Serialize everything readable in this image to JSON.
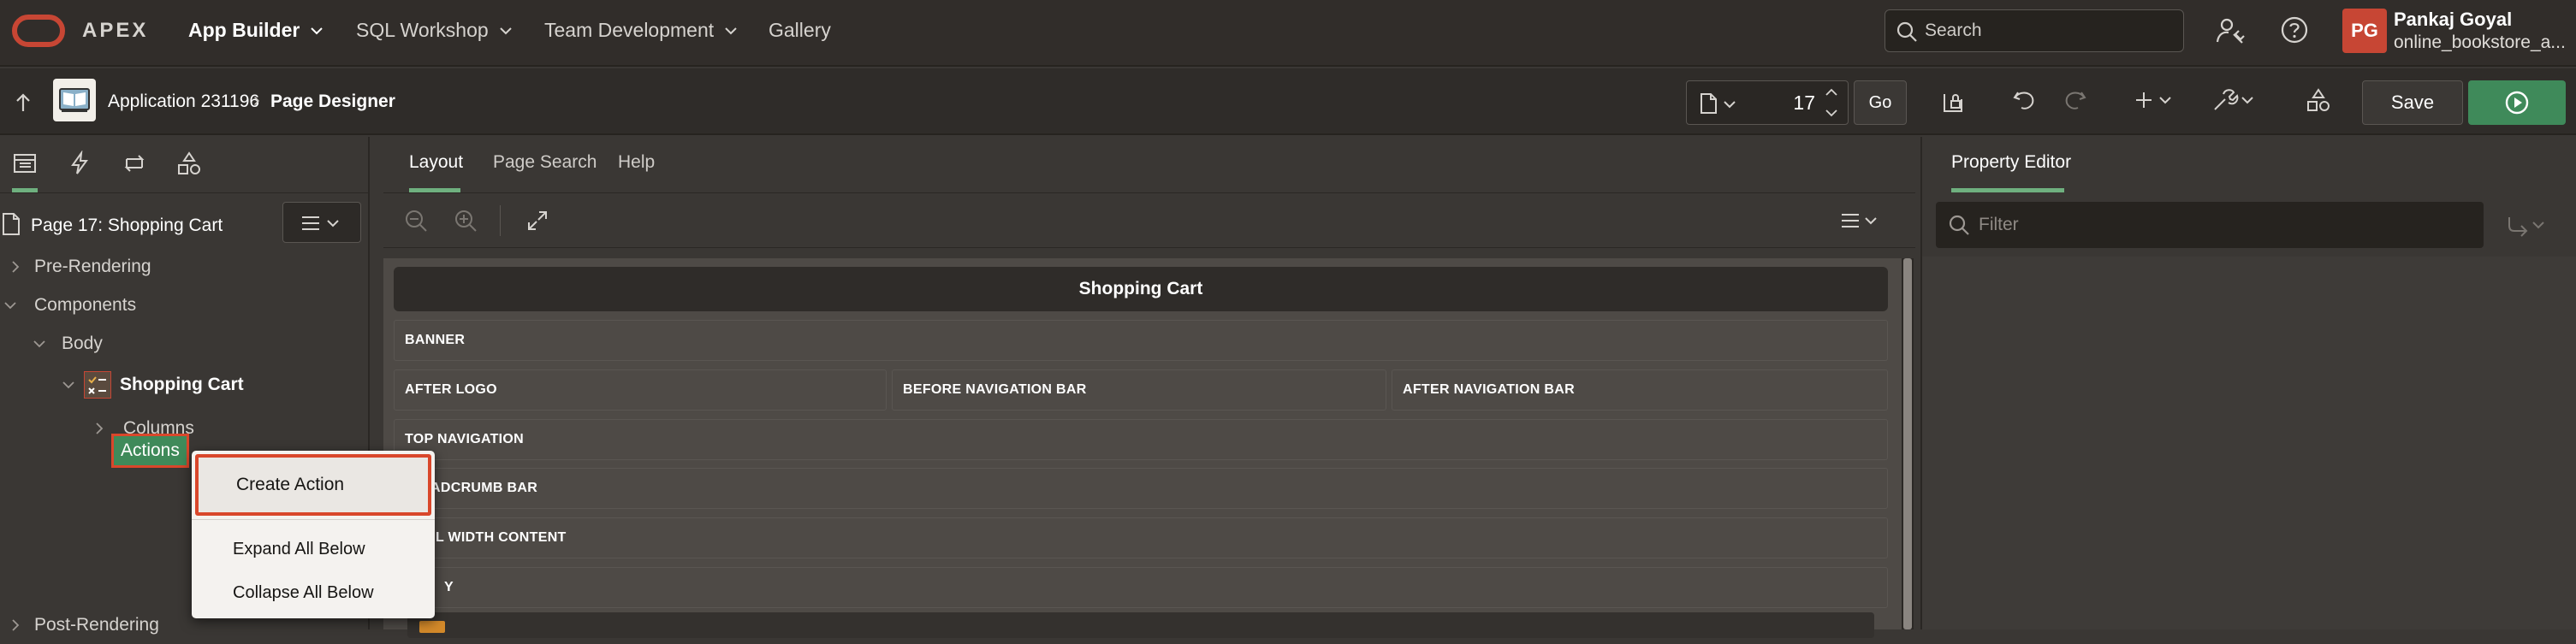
{
  "topbar": {
    "brand": "APEX",
    "nav": [
      {
        "label": "App Builder",
        "active": true
      },
      {
        "label": "SQL Workshop",
        "has_dropdown": true
      },
      {
        "label": "Team Development",
        "has_dropdown": true
      },
      {
        "label": "Gallery"
      }
    ],
    "search_placeholder": "Search",
    "user": {
      "initials": "PG",
      "name": "Pankaj Goyal",
      "workspace": "online_bookstore_a..."
    }
  },
  "toolbar": {
    "app_name": "Application 231196",
    "page_designer": "Page Designer",
    "page_number": "17",
    "go_label": "Go",
    "save_label": "Save"
  },
  "left_panel": {
    "page_node": "Page 17: Shopping Cart",
    "tree": {
      "pre_rendering": "Pre-Rendering",
      "components": "Components",
      "body": "Body",
      "region": "Shopping Cart",
      "columns": "Columns",
      "actions": "Actions",
      "post_rendering": "Post-Rendering"
    }
  },
  "context_menu": {
    "items": [
      "Create Action",
      "Expand All Below",
      "Collapse All Below"
    ]
  },
  "center_panel": {
    "tabs": [
      {
        "label": "Layout",
        "active": true
      },
      {
        "label": "Page Search"
      },
      {
        "label": "Help"
      }
    ],
    "page_title": "Shopping Cart",
    "regions": {
      "banner": "BANNER",
      "after_logo": "AFTER LOGO",
      "before_nav_bar": "BEFORE NAVIGATION BAR",
      "after_nav_bar": "AFTER NAVIGATION BAR",
      "top_navigation": "TOP NAVIGATION",
      "breadcrumb_bar": "ADCRUMB BAR",
      "full_width": "L WIDTH CONTENT",
      "body": "Y"
    }
  },
  "right_panel": {
    "tab": "Property Editor",
    "filter_placeholder": "Filter"
  },
  "colors": {
    "accent_green": "#3f8a5a",
    "tab_indicator": "#6fb07f",
    "highlight_red": "#d9472b",
    "avatar_red": "#c74634"
  }
}
